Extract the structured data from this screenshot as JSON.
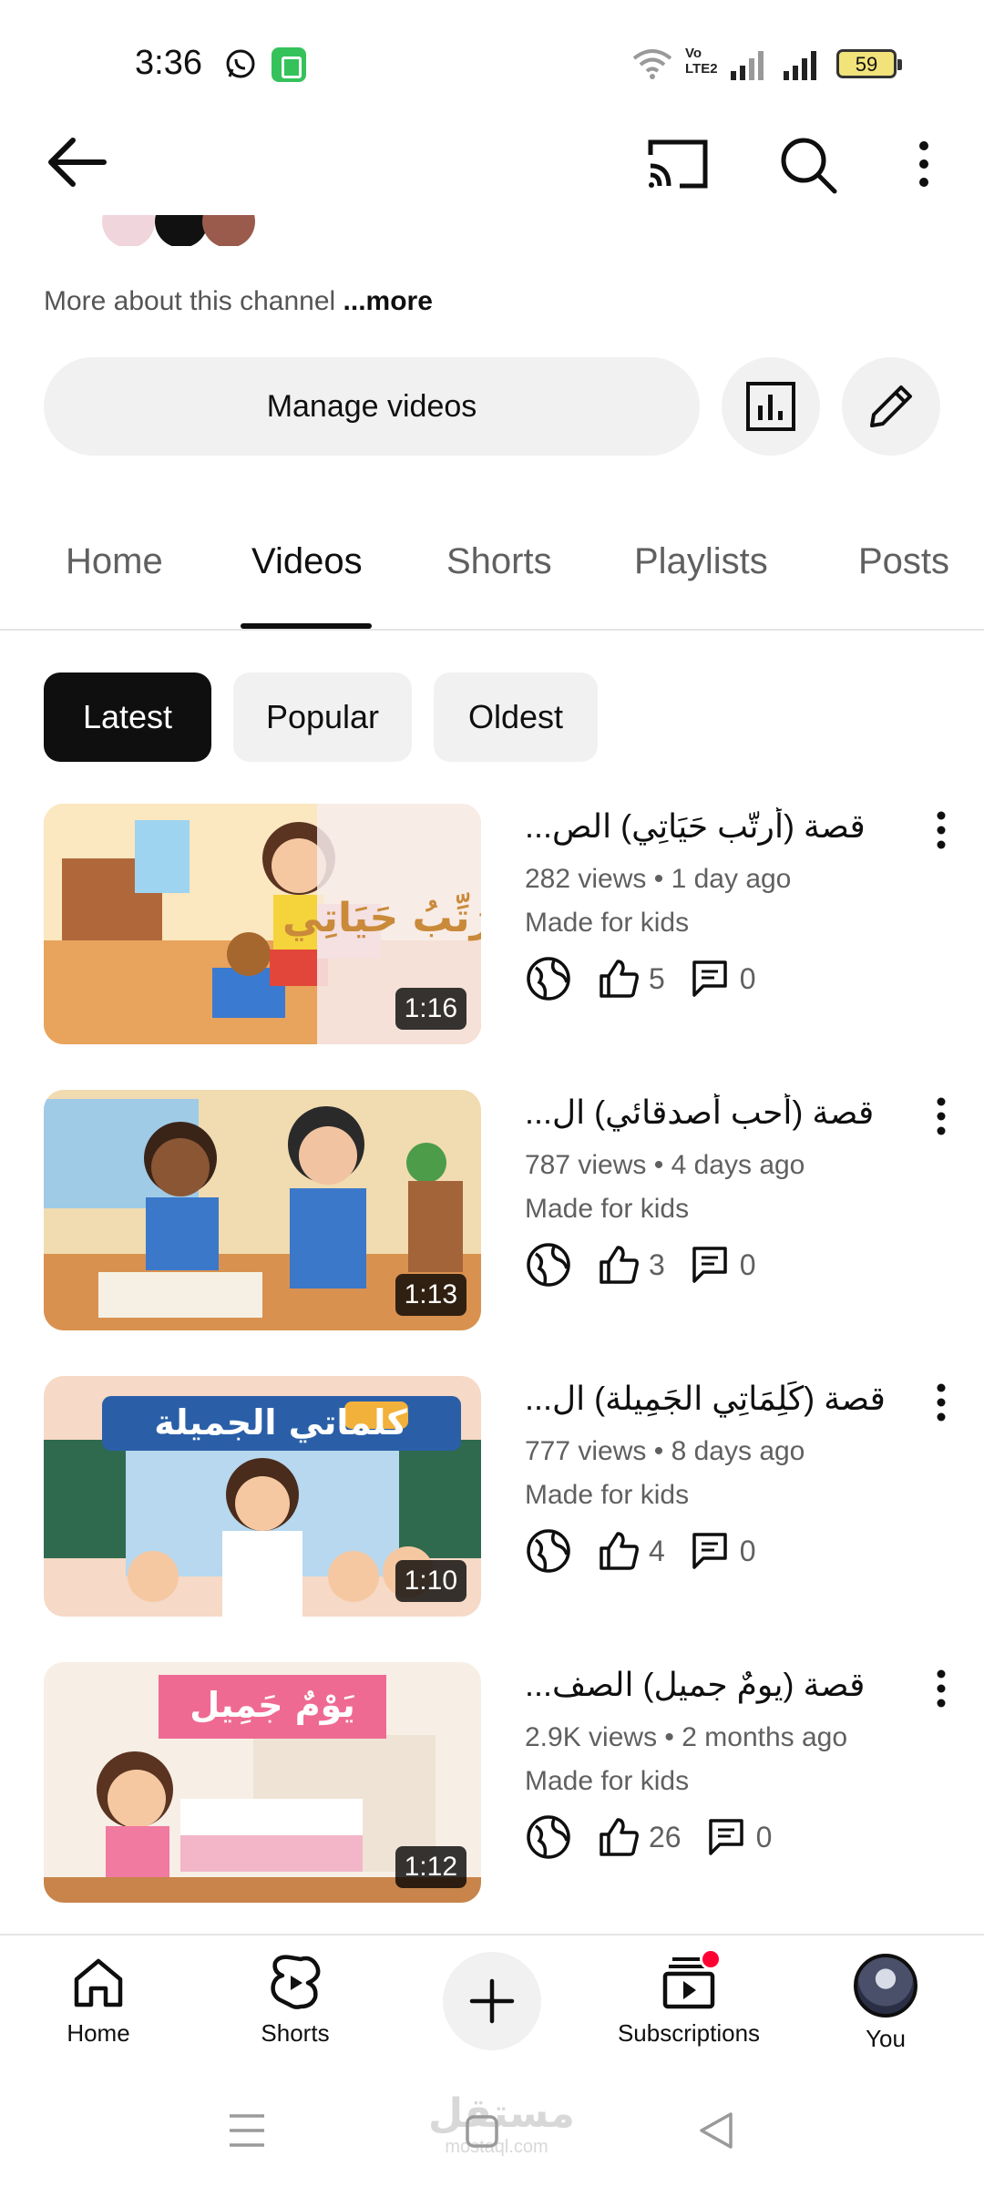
{
  "status_bar": {
    "time": "3:36",
    "battery": "59",
    "volte_line1": "Vo",
    "volte_line2": "LTE2"
  },
  "header": {
    "icons": [
      "back-arrow-icon",
      "cast-icon",
      "search-icon",
      "more-vert-icon"
    ]
  },
  "channel": {
    "about_text": "More about this channel",
    "about_more": " ...more",
    "manage_label": "Manage videos"
  },
  "tabs": [
    {
      "label": "Home",
      "active": false
    },
    {
      "label": "Videos",
      "active": true
    },
    {
      "label": "Shorts",
      "active": false
    },
    {
      "label": "Playlists",
      "active": false
    },
    {
      "label": "Posts",
      "active": false
    }
  ],
  "chips": [
    {
      "label": "Latest",
      "selected": true
    },
    {
      "label": "Popular",
      "selected": false
    },
    {
      "label": "Oldest",
      "selected": false
    }
  ],
  "videos": [
    {
      "title": "قصة (أرتّب حَيَاتِي) الص...",
      "views": "282 views",
      "age": "1 day ago",
      "kids": "Made for kids",
      "likes": "5",
      "comments": "0",
      "duration": "1:16",
      "thumb_text": "أرَتِّبُ حَيَاتِي"
    },
    {
      "title": "قصة (أحب أصدقائي) ال...",
      "views": "787 views",
      "age": "4 days ago",
      "kids": "Made for kids",
      "likes": "3",
      "comments": "0",
      "duration": "1:13",
      "thumb_text": ""
    },
    {
      "title": "قصة (كَلِمَاتِي الجَمِيلة) ال...",
      "views": "777 views",
      "age": "8 days ago",
      "kids": "Made for kids",
      "likes": "4",
      "comments": "0",
      "duration": "1:10",
      "thumb_text": "كلماتي الجميلة"
    },
    {
      "title": "قصة (يومٌ جميل) الصف...",
      "views": "2.9K views",
      "age": "2 months ago",
      "kids": "Made for kids",
      "likes": "26",
      "comments": "0",
      "duration": "1:12",
      "thumb_text": "يَوْمٌ جَمِيل"
    }
  ],
  "bottom_nav": {
    "home": "Home",
    "shorts": "Shorts",
    "subscriptions": "Subscriptions",
    "you": "You"
  },
  "watermark": {
    "main": "مستقل",
    "sub": "mostaql.com"
  },
  "colors": {
    "accent_red": "#ff0033",
    "chip_selected": "#0f0f0f",
    "chip_bg": "#f1f1f1"
  }
}
